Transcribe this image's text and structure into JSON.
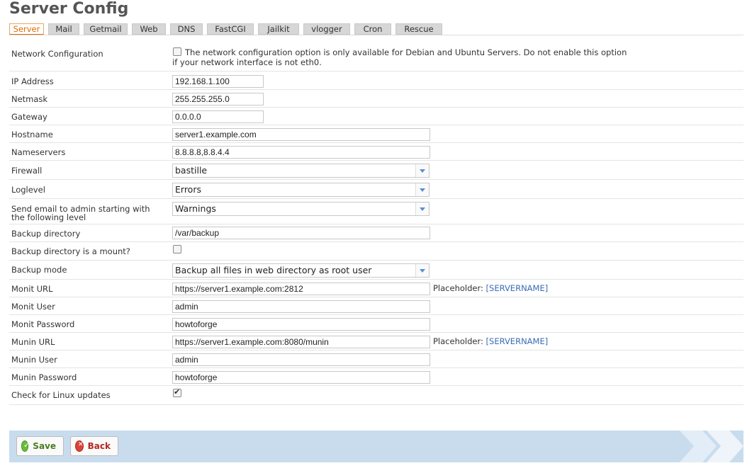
{
  "page": {
    "title": "Server Config"
  },
  "tabs": [
    {
      "label": "Server",
      "active": true
    },
    {
      "label": "Mail"
    },
    {
      "label": "Getmail"
    },
    {
      "label": "Web"
    },
    {
      "label": "DNS"
    },
    {
      "label": "FastCGI"
    },
    {
      "label": "Jailkit"
    },
    {
      "label": "vlogger"
    },
    {
      "label": "Cron"
    },
    {
      "label": "Rescue"
    }
  ],
  "form": {
    "network_configuration": {
      "label": "Network Configuration",
      "checked": false,
      "note_line1": "The network configuration option is only available for Debian and Ubuntu Servers. Do not enable this option",
      "note_line2": "if your network interface is not eth0."
    },
    "ip_address": {
      "label": "IP Address",
      "value": "192.168.1.100"
    },
    "netmask": {
      "label": "Netmask",
      "value": "255.255.255.0"
    },
    "gateway": {
      "label": "Gateway",
      "value": "0.0.0.0"
    },
    "hostname": {
      "label": "Hostname",
      "value": "server1.example.com"
    },
    "nameservers": {
      "label": "Nameservers",
      "value": "8.8.8.8,8.8.4.4"
    },
    "firewall": {
      "label": "Firewall",
      "value": "bastille"
    },
    "loglevel": {
      "label": "Loglevel",
      "value": "Errors"
    },
    "admin_mail_level": {
      "label_line1": "Send email to admin starting with",
      "label_line2": "the following level",
      "value": "Warnings"
    },
    "backup_directory": {
      "label": "Backup directory",
      "value": "/var/backup"
    },
    "backup_is_mount": {
      "label": "Backup directory is a mount?",
      "checked": false
    },
    "backup_mode": {
      "label": "Backup mode",
      "value": "Backup all files in web directory as root user"
    },
    "monit_url": {
      "label": "Monit URL",
      "value": "https://server1.example.com:2812",
      "placeholder_label": "Placeholder:",
      "placeholder_tag": "[SERVERNAME]"
    },
    "monit_user": {
      "label": "Monit User",
      "value": "admin"
    },
    "monit_password": {
      "label": "Monit Password",
      "value": "howtoforge"
    },
    "munin_url": {
      "label": "Munin URL",
      "value": "https://server1.example.com:8080/munin",
      "placeholder_label": "Placeholder:",
      "placeholder_tag": "[SERVERNAME]"
    },
    "munin_user": {
      "label": "Munin User",
      "value": "admin"
    },
    "munin_password": {
      "label": "Munin Password",
      "value": "howtoforge"
    },
    "linux_updates": {
      "label": "Check for Linux updates",
      "checked": true
    }
  },
  "footer": {
    "save_label": "Save",
    "back_label": "Back"
  },
  "icons": {
    "save": "check-circle-icon",
    "back": "x-circle-icon",
    "decor": "double-chevron-icon"
  }
}
